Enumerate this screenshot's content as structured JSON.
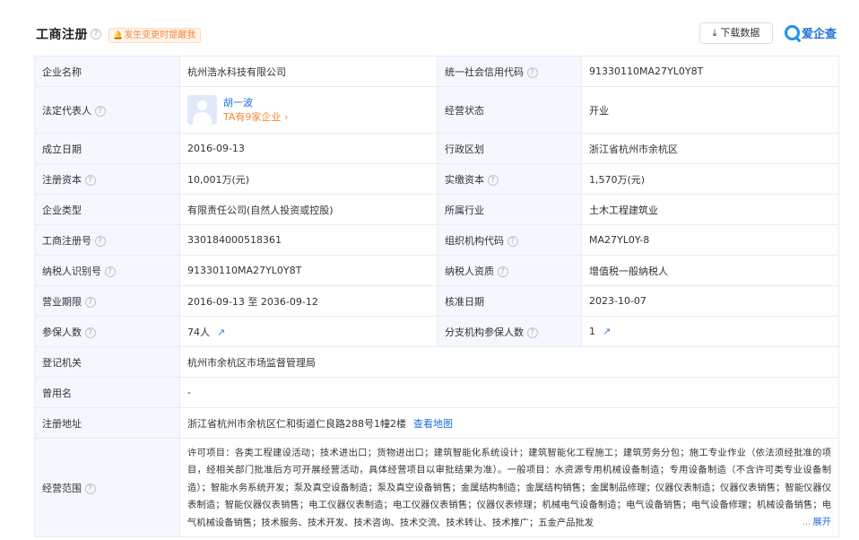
{
  "header": {
    "title": "工商注册",
    "notice": "发生变更时提醒我",
    "download_label": "下载数据",
    "logo_text": "爱企查"
  },
  "company": {
    "name_label": "企业名称",
    "name": "杭州浩水科技有限公司",
    "credit_code_label": "统一社会信用代码",
    "credit_code": "91330110MA27YL0Y8T",
    "legal_rep_label": "法定代表人",
    "legal_rep_name": "胡一波",
    "legal_rep_link": "TA有9家企业",
    "status_label": "经营状态",
    "status": "开业",
    "founded_label": "成立日期",
    "founded": "2016-09-13",
    "region_label": "行政区划",
    "region": "浙江省杭州市余杭区",
    "reg_capital_label": "注册资本",
    "reg_capital": "10,001万(元)",
    "paid_capital_label": "实缴资本",
    "paid_capital": "1,570万(元)",
    "type_label": "企业类型",
    "type": "有限责任公司(自然人投资或控股)",
    "industry_label": "所属行业",
    "industry": "土木工程建筑业",
    "reg_no_label": "工商注册号",
    "reg_no": "330184000518361",
    "org_code_label": "组织机构代码",
    "org_code": "MA27YL0Y-8",
    "taxpayer_id_label": "纳税人识别号",
    "taxpayer_id": "91330110MA27YL0Y8T",
    "taxpayer_qual_label": "纳税人资质",
    "taxpayer_qual": "增值税一般纳税人",
    "term_label": "营业期限",
    "term": "2016-09-13 至 2036-09-12",
    "approved_label": "核准日期",
    "approved": "2023-10-07",
    "insured_label": "参保人数",
    "insured": "74人",
    "branch_insured_label": "分支机构参保人数",
    "branch_insured": "1",
    "authority_label": "登记机关",
    "authority": "杭州市余杭区市场监督管理局",
    "former_name_label": "曾用名",
    "former_name": "-",
    "address_label": "注册地址",
    "address": "浙江省杭州市余杭区仁和街道仁良路288号1幢2楼",
    "map_link": "查看地图",
    "scope_label": "经营范围",
    "scope": "许可项目：各类工程建设活动；技术进出口；货物进出口；建筑智能化系统设计；建筑智能化工程施工；建筑劳务分包；施工专业作业（依法须经批准的项目，经相关部门批准后方可开展经营活动，具体经营项目以审批结果为准）。一般项目：水资源专用机械设备制造；专用设备制造（不含许可类专业设备制造）；智能水务系统开发；泵及真空设备制造；泵及真空设备销售；金属结构制造；金属结构销售；金属制品修理；仪器仪表制造；仪器仪表销售；智能仪器仪表制造；智能仪器仪表销售；电工仪器仪表制造；电工仪器仪表销售；仪器仪表修理；机械电气设备制造；电气设备销售；电气设备修理；机械设备销售；电气机械设备销售；技术服务、技术开发、技术咨询、技术交流、技术转让、技术推广；五金产品批发",
    "expand_label": "展开",
    "ellipsis": "..."
  }
}
